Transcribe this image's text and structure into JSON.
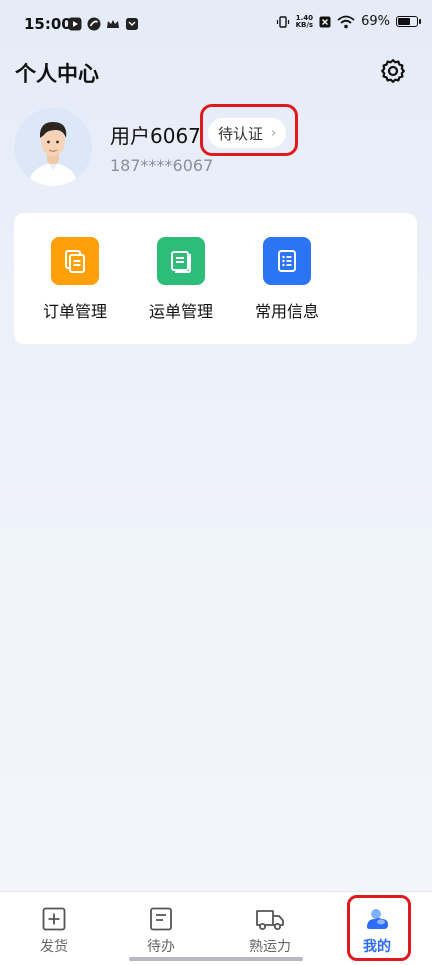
{
  "status_bar": {
    "time": "15:00",
    "net_speed_value": "1.40",
    "net_speed_unit": "KB/s",
    "battery": "69%",
    "battery_level": 0.69
  },
  "header": {
    "title": "个人中心"
  },
  "profile": {
    "username": "用户6067",
    "verify_label": "待认证",
    "verify_chevron": "›",
    "phone": "187****6067"
  },
  "menu": {
    "items": [
      {
        "label": "订单管理",
        "icon": "order-doc-icon",
        "color": "#ff9f0a"
      },
      {
        "label": "运单管理",
        "icon": "waybill-doc-icon",
        "color": "#2ebd78"
      },
      {
        "label": "常用信息",
        "icon": "list-doc-icon",
        "color": "#2b74f3"
      }
    ]
  },
  "bottom_nav": {
    "items": [
      {
        "label": "发货",
        "icon": "plus-square-icon",
        "active": false
      },
      {
        "label": "待办",
        "icon": "todo-list-icon",
        "active": false
      },
      {
        "label": "熟运力",
        "icon": "truck-icon",
        "active": false
      },
      {
        "label": "我的",
        "icon": "profile-cloud-icon",
        "active": true
      }
    ]
  },
  "colors": {
    "accent": "#2d6cf6",
    "highlight": "#e0191e"
  }
}
